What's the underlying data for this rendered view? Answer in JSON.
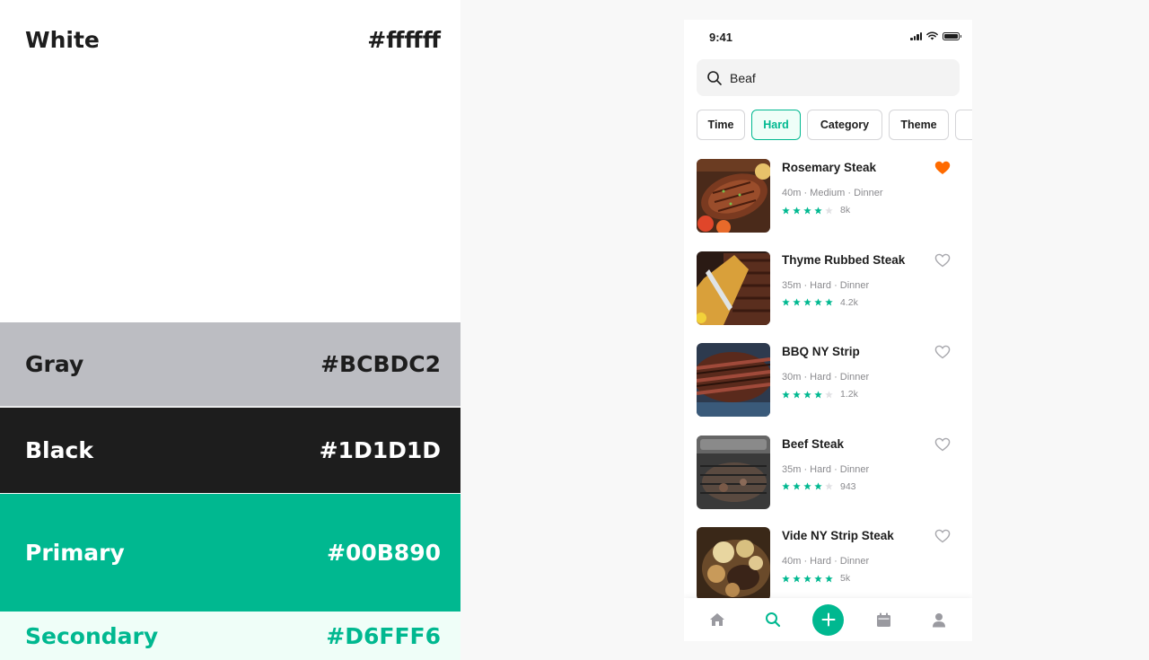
{
  "palette": [
    {
      "name": "White",
      "hex": "#ffffff"
    },
    {
      "name": "Gray",
      "hex": "#BCBDC2"
    },
    {
      "name": "Black",
      "hex": "#1D1D1D"
    },
    {
      "name": "Primary",
      "hex": "#00B890"
    },
    {
      "name": "Secondary",
      "hex": "#D6FFF6"
    }
  ],
  "colors": {
    "primary": "#00B890",
    "heart_active": "#FF6B00",
    "text": "#1D1D1D",
    "muted": "#8A8A8E"
  },
  "status": {
    "time": "9:41"
  },
  "search": {
    "value": "Beaf"
  },
  "filters": [
    {
      "label": "Time",
      "active": false
    },
    {
      "label": "Hard",
      "active": true
    },
    {
      "label": "Category",
      "active": false
    },
    {
      "label": "Theme",
      "active": false
    },
    {
      "label": "",
      "active": false
    }
  ],
  "recipes": [
    {
      "title": "Rosemary Steak",
      "meta": "40m · Medium · Dinner",
      "stars": 4,
      "count": "8k",
      "favorite": true
    },
    {
      "title": "Thyme Rubbed Steak",
      "meta": "35m · Hard · Dinner",
      "stars": 5,
      "count": "4.2k",
      "favorite": false
    },
    {
      "title": "BBQ NY Strip",
      "meta": "30m · Hard · Dinner",
      "stars": 4,
      "count": "1.2k",
      "favorite": false
    },
    {
      "title": "Beef Steak",
      "meta": "35m · Hard · Dinner",
      "stars": 4,
      "count": "943",
      "favorite": false
    },
    {
      "title": "Vide NY Strip Steak",
      "meta": "40m · Hard · Dinner",
      "stars": 5,
      "count": "5k",
      "favorite": false
    }
  ],
  "tabbar": [
    {
      "icon": "home-icon",
      "active": false
    },
    {
      "icon": "search-icon",
      "active": true
    },
    {
      "icon": "plus-icon",
      "active": false
    },
    {
      "icon": "calendar-icon",
      "active": false
    },
    {
      "icon": "profile-icon",
      "active": false
    }
  ]
}
